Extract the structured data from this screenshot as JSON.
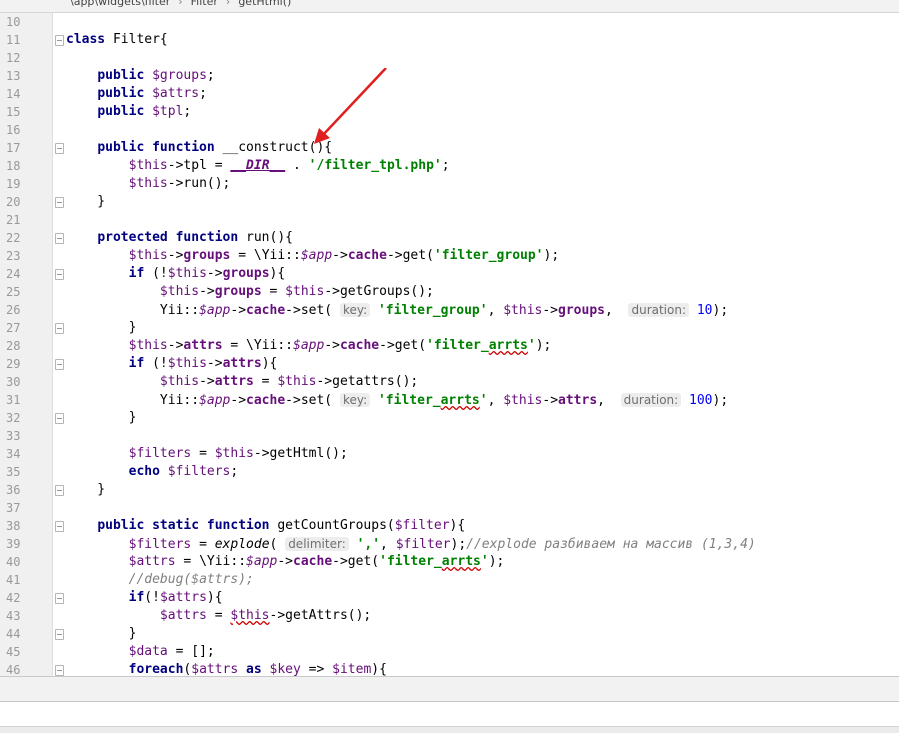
{
  "breadcrumb": {
    "path": "\\app\\widgets\\filter",
    "class": "Filter",
    "method": "getHtml()"
  },
  "colors": {
    "keyword": "#000080",
    "variable": "#660e7a",
    "string": "#008000",
    "comment": "#808080",
    "number": "#0000ff",
    "annotation_arrow": "#e02020"
  },
  "code_lines": [
    {
      "n": "10",
      "html": ""
    },
    {
      "n": "11",
      "html": "<span class=\"kw\">class</span> Filter{"
    },
    {
      "n": "12",
      "html": ""
    },
    {
      "n": "13",
      "html": "    <span class=\"kw\">public</span> <span class=\"var\">$groups</span>;"
    },
    {
      "n": "14",
      "html": "    <span class=\"kw\">public</span> <span class=\"var\">$attrs</span>;"
    },
    {
      "n": "15",
      "html": "    <span class=\"kw\">public</span> <span class=\"var\">$tpl</span>;"
    },
    {
      "n": "16",
      "html": ""
    },
    {
      "n": "17",
      "html": "    <span class=\"kw\">public function</span> __construct(){"
    },
    {
      "n": "18",
      "html": "        <span class=\"var\">$this</span>-&gt;tpl = <span class=\"const underline\">__DIR__</span> . <span class=\"str\">'/filter_tpl.php'</span>;"
    },
    {
      "n": "19",
      "html": "        <span class=\"var\">$this</span>-&gt;run();"
    },
    {
      "n": "20",
      "html": "    }"
    },
    {
      "n": "21",
      "html": ""
    },
    {
      "n": "22",
      "html": "    <span class=\"kw\">protected function</span> run(){"
    },
    {
      "n": "23",
      "html": "        <span class=\"var\">$this</span>-&gt;<span class=\"field\">groups</span> = \\Yii::<span class=\"var ital\">$app</span>-&gt;<span class=\"field\">cache</span>-&gt;get(<span class=\"str\">'filter_group'</span>);"
    },
    {
      "n": "24",
      "html": "        <span class=\"kw\">if</span> (!<span class=\"var\">$this</span>-&gt;<span class=\"field\">groups</span>){"
    },
    {
      "n": "25",
      "html": "            <span class=\"var\">$this</span>-&gt;<span class=\"field\">groups</span> = <span class=\"var\">$this</span>-&gt;getGroups();"
    },
    {
      "n": "26",
      "html": "            Yii::<span class=\"var ital\">$app</span>-&gt;<span class=\"field\">cache</span>-&gt;set( <span class=\"hint\">key:</span> <span class=\"str\">'filter_group'</span>, <span class=\"var\">$this</span>-&gt;<span class=\"field\">groups</span>,  <span class=\"hint\">duration:</span> <span class=\"num\">10</span>);"
    },
    {
      "n": "27",
      "html": "        }"
    },
    {
      "n": "28",
      "html": "        <span class=\"var\">$this</span>-&gt;<span class=\"field\">attrs</span> = \\Yii::<span class=\"var ital\">$app</span>-&gt;<span class=\"field\">cache</span>-&gt;get(<span class=\"str\">'filter_<span class=\"squig\">arrts</span>'</span>);"
    },
    {
      "n": "29",
      "html": "        <span class=\"kw\">if</span> (!<span class=\"var\">$this</span>-&gt;<span class=\"field\">attrs</span>){"
    },
    {
      "n": "30",
      "html": "            <span class=\"var\">$this</span>-&gt;<span class=\"field\">attrs</span> = <span class=\"var\">$this</span>-&gt;getattrs();"
    },
    {
      "n": "31",
      "html": "            Yii::<span class=\"var ital\">$app</span>-&gt;<span class=\"field\">cache</span>-&gt;set( <span class=\"hint\">key:</span> <span class=\"str\">'filter_<span class=\"squig\">arrts</span>'</span>, <span class=\"var\">$this</span>-&gt;<span class=\"field\">attrs</span>,  <span class=\"hint\">duration:</span> <span class=\"num\">100</span>);"
    },
    {
      "n": "32",
      "html": "        }"
    },
    {
      "n": "33",
      "html": ""
    },
    {
      "n": "34",
      "html": "        <span class=\"var\">$filters</span> = <span class=\"var\">$this</span>-&gt;getHtml();"
    },
    {
      "n": "35",
      "html": "        <span class=\"kw\">echo</span> <span class=\"var\">$filters</span>;"
    },
    {
      "n": "36",
      "html": "    }"
    },
    {
      "n": "37",
      "html": ""
    },
    {
      "n": "38",
      "html": "    <span class=\"kw\">public static function</span> getCountGroups(<span class=\"var\">$filter</span>){"
    },
    {
      "n": "39",
      "html": "        <span class=\"var\">$filters</span> = <span class=\"ital\">explode</span>( <span class=\"hint\">delimiter:</span> <span class=\"str\">','</span>, <span class=\"var\">$filter</span>);<span class=\"cmt\">//explode разбиваем на массив (1,3,4)</span>"
    },
    {
      "n": "40",
      "html": "        <span class=\"var\">$attrs</span> = \\Yii::<span class=\"var ital\">$app</span>-&gt;<span class=\"field\">cache</span>-&gt;get(<span class=\"str\">'filter_<span class=\"squig\">arrts</span>'</span>);"
    },
    {
      "n": "41",
      "html": "        <span class=\"cmt\">//debug($attrs);</span>"
    },
    {
      "n": "42",
      "html": "        <span class=\"kw\">if</span>(!<span class=\"var\">$attrs</span>){"
    },
    {
      "n": "43",
      "html": "            <span class=\"var\">$attrs</span> = <span class=\"var squig\">$this</span>-&gt;getAttrs();"
    },
    {
      "n": "44",
      "html": "        }"
    },
    {
      "n": "45",
      "html": "        <span class=\"var\">$data</span> = [];"
    },
    {
      "n": "46",
      "html": "        <span class=\"kw\">foreach</span>(<span class=\"var\">$attrs</span> <span class=\"kw\">as</span> <span class=\"var\">$key</span> =&gt; <span class=\"var\">$item</span>){"
    }
  ],
  "fold_markers": [
    "11",
    "17",
    "20",
    "22",
    "24",
    "27",
    "29",
    "32",
    "36",
    "38",
    "42",
    "44",
    "46"
  ]
}
